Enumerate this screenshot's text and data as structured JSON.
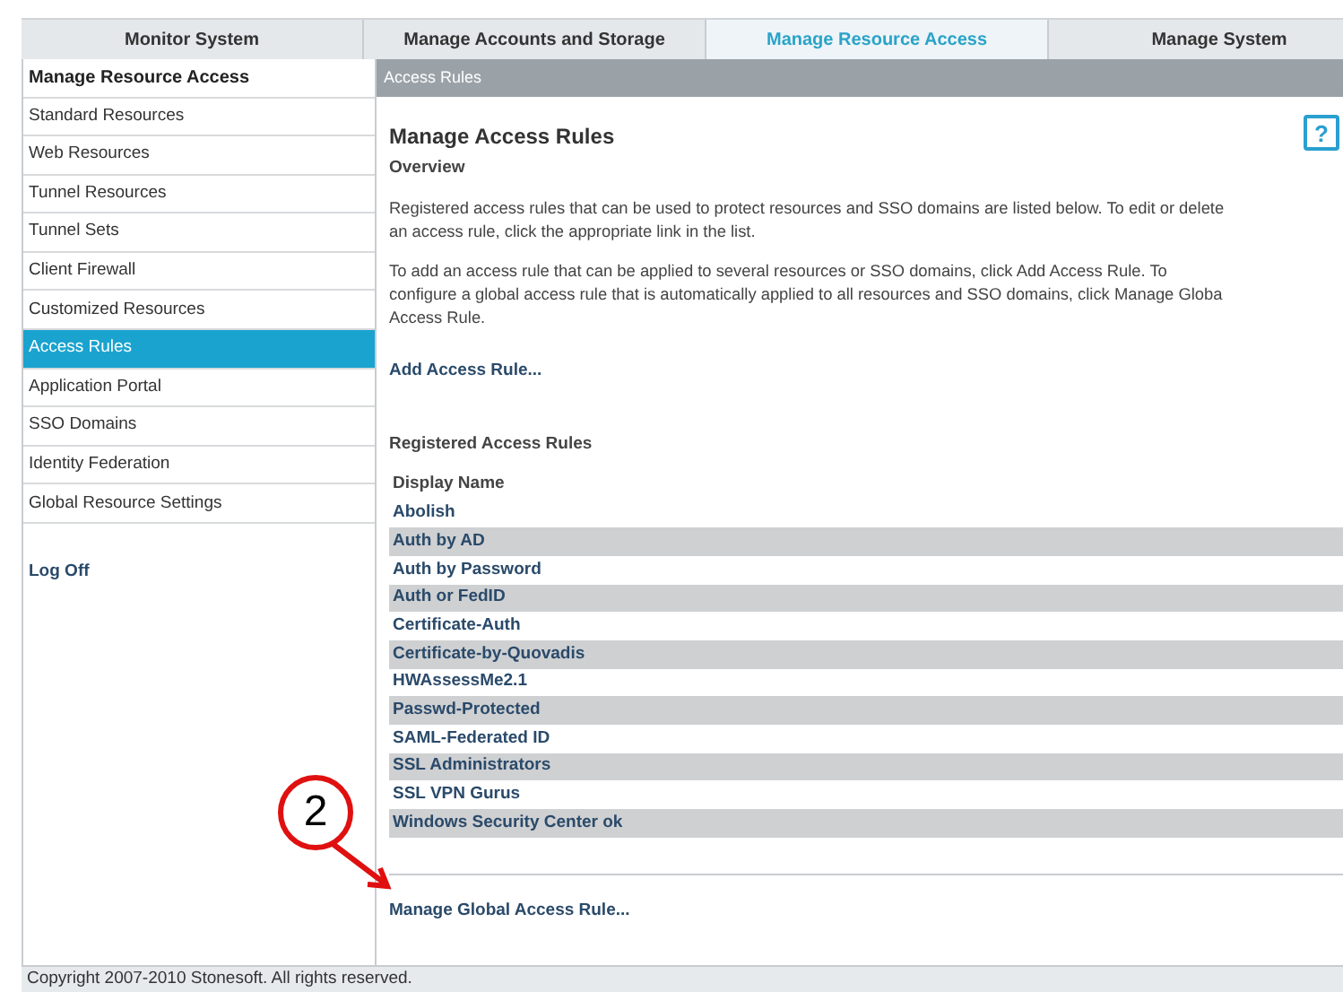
{
  "tabs": [
    {
      "label": "Monitor System",
      "selected": false
    },
    {
      "label": "Manage Accounts and Storage",
      "selected": false
    },
    {
      "label": "Manage Resource Access",
      "selected": true
    },
    {
      "label": "Manage System",
      "selected": false
    }
  ],
  "sidebar": {
    "title": "Manage Resource Access",
    "items": [
      {
        "label": "Standard Resources",
        "selected": false
      },
      {
        "label": "Web Resources",
        "selected": false
      },
      {
        "label": "Tunnel Resources",
        "selected": false
      },
      {
        "label": "Tunnel Sets",
        "selected": false
      },
      {
        "label": "Client Firewall",
        "selected": false
      },
      {
        "label": "Customized Resources",
        "selected": false
      },
      {
        "label": "Access Rules",
        "selected": true
      },
      {
        "label": "Application Portal",
        "selected": false
      },
      {
        "label": "SSO Domains",
        "selected": false
      },
      {
        "label": "Identity Federation",
        "selected": false
      },
      {
        "label": "Global Resource Settings",
        "selected": false
      }
    ],
    "logoff": "Log Off"
  },
  "breadcrumb": "Access Rules",
  "content": {
    "title": "Manage Access Rules",
    "help": "?",
    "overview_heading": "Overview",
    "paragraphs": [
      [
        "Registered access rules that can be used to protect resources and SSO domains are listed below. To edit or delete",
        "an access rule, click the appropriate link in the list."
      ],
      [
        "To add an access rule that can be applied to several resources or SSO domains, click Add Access Rule. To",
        "configure a global access rule that is automatically applied to all resources and SSO domains, click Manage Globa",
        "Access Rule."
      ]
    ],
    "add_link": "Add Access Rule...",
    "rules_heading": "Registered Access Rules",
    "table": {
      "columns": [
        "Display Name"
      ],
      "rows": [
        "Abolish",
        "Auth by AD",
        "Auth by Password",
        "Auth or FedID",
        "Certificate-Auth",
        "Certificate-by-Quovadis",
        "HWAssessMe2.1",
        "Passwd-Protected",
        "SAML-Federated ID",
        "SSL Administrators",
        "SSL VPN Gurus",
        "Windows Security Center ok"
      ]
    },
    "global_link": "Manage Global Access Rule..."
  },
  "callout": {
    "label": "2"
  },
  "footer": "Copyright 2007-2010 Stonesoft. All rights reserved."
}
